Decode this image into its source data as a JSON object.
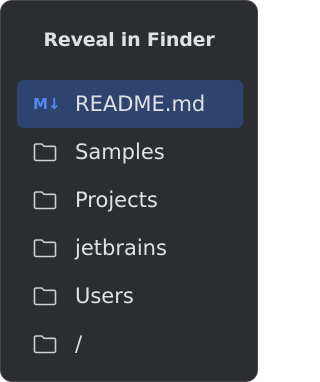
{
  "popup": {
    "title": "Reveal in Finder",
    "items": [
      {
        "label": "README.md",
        "icon": "markdown-file-icon",
        "selected": true
      },
      {
        "label": "Samples",
        "icon": "folder-icon",
        "selected": false
      },
      {
        "label": "Projects",
        "icon": "folder-icon",
        "selected": false
      },
      {
        "label": "jetbrains",
        "icon": "folder-icon",
        "selected": false
      },
      {
        "label": "Users",
        "icon": "folder-icon",
        "selected": false
      },
      {
        "label": "/",
        "icon": "folder-icon",
        "selected": false
      }
    ],
    "markdown_icon_glyph": "M↓"
  },
  "colors": {
    "background": "#2b2d30",
    "border": "#45474b",
    "selection": "#2e436e",
    "text": "#dfe1e5",
    "markdown_accent": "#548af7",
    "folder_stroke": "#ced0d6"
  }
}
